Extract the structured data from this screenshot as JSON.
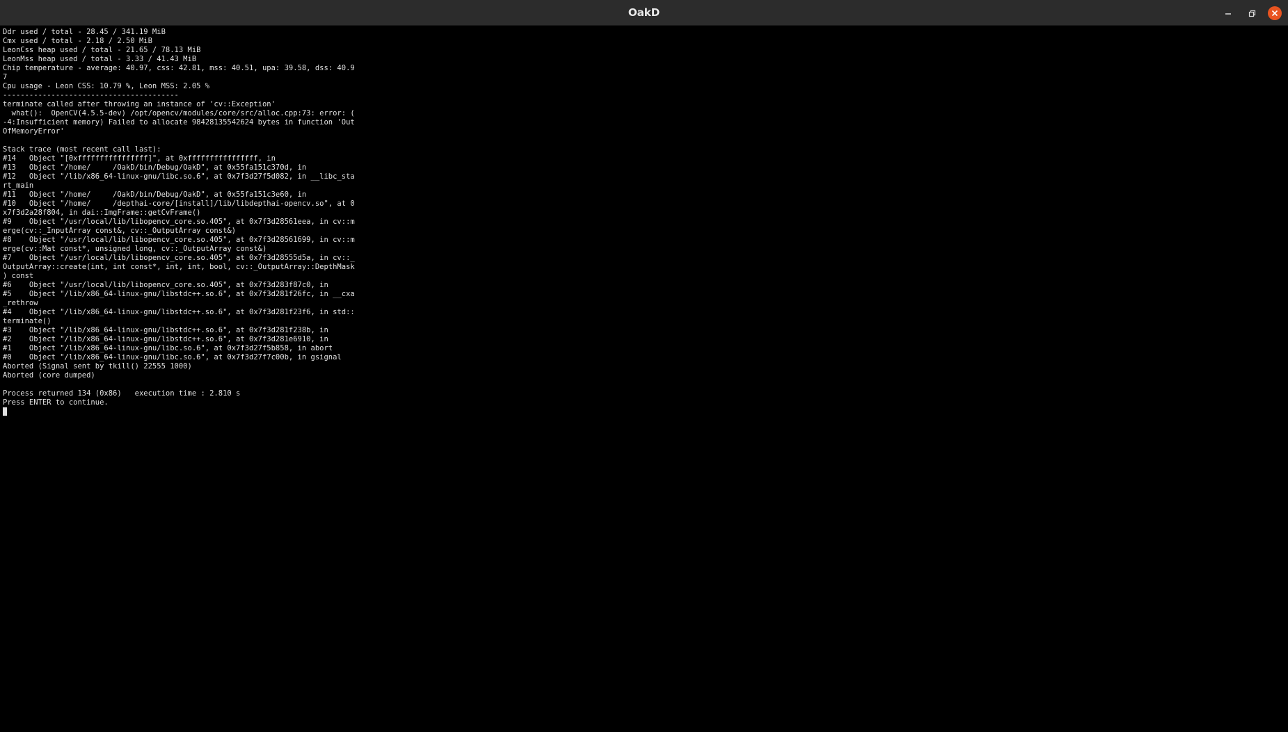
{
  "window": {
    "title": "OakD",
    "controls": {
      "minimize_icon": "minimize-icon",
      "maximize_icon": "restore-icon",
      "close_icon": "close-icon",
      "close_color": "#e95420"
    }
  },
  "terminal": {
    "lines": [
      "Ddr used / total - 28.45 / 341.19 MiB",
      "Cmx used / total - 2.18 / 2.50 MiB",
      "LeonCss heap used / total - 21.65 / 78.13 MiB",
      "LeonMss heap used / total - 3.33 / 41.43 MiB",
      "Chip temperature - average: 40.97, css: 42.81, mss: 40.51, upa: 39.58, dss: 40.9",
      "7",
      "Cpu usage - Leon CSS: 10.79 %, Leon MSS: 2.05 %",
      "----------------------------------------",
      "terminate called after throwing an instance of 'cv::Exception'",
      "  what():  OpenCV(4.5.5-dev) /opt/opencv/modules/core/src/alloc.cpp:73: error: (",
      "-4:Insufficient memory) Failed to allocate 98428135542624 bytes in function 'Out",
      "OfMemoryError'",
      "",
      "Stack trace (most recent call last):",
      "#14   Object \"[0xffffffffffffffff]\", at 0xffffffffffffffff, in",
      "#13   Object \"/home/     /OakD/bin/Debug/OakD\", at 0x55fa151c370d, in",
      "#12   Object \"/lib/x86_64-linux-gnu/libc.so.6\", at 0x7f3d27f5d082, in __libc_sta",
      "rt_main",
      "#11   Object \"/home/     /OakD/bin/Debug/OakD\", at 0x55fa151c3e60, in",
      "#10   Object \"/home/     /depthai-core/[install]/lib/libdepthai-opencv.so\", at 0",
      "x7f3d2a28f804, in dai::ImgFrame::getCvFrame()",
      "#9    Object \"/usr/local/lib/libopencv_core.so.405\", at 0x7f3d28561eea, in cv::m",
      "erge(cv::_InputArray const&, cv::_OutputArray const&)",
      "#8    Object \"/usr/local/lib/libopencv_core.so.405\", at 0x7f3d28561699, in cv::m",
      "erge(cv::Mat const*, unsigned long, cv::_OutputArray const&)",
      "#7    Object \"/usr/local/lib/libopencv_core.so.405\", at 0x7f3d28555d5a, in cv::_",
      "OutputArray::create(int, int const*, int, int, bool, cv::_OutputArray::DepthMask",
      ") const",
      "#6    Object \"/usr/local/lib/libopencv_core.so.405\", at 0x7f3d283f87c0, in",
      "#5    Object \"/lib/x86_64-linux-gnu/libstdc++.so.6\", at 0x7f3d281f26fc, in __cxa",
      "_rethrow",
      "#4    Object \"/lib/x86_64-linux-gnu/libstdc++.so.6\", at 0x7f3d281f23f6, in std::",
      "terminate()",
      "#3    Object \"/lib/x86_64-linux-gnu/libstdc++.so.6\", at 0x7f3d281f238b, in",
      "#2    Object \"/lib/x86_64-linux-gnu/libstdc++.so.6\", at 0x7f3d281e6910, in",
      "#1    Object \"/lib/x86_64-linux-gnu/libc.so.6\", at 0x7f3d27f5b858, in abort",
      "#0    Object \"/lib/x86_64-linux-gnu/libc.so.6\", at 0x7f3d27f7c00b, in gsignal",
      "Aborted (Signal sent by tkill() 22555 1000)",
      "Aborted (core dumped)",
      "",
      "Process returned 134 (0x86)   execution time : 2.810 s",
      "Press ENTER to continue."
    ]
  }
}
